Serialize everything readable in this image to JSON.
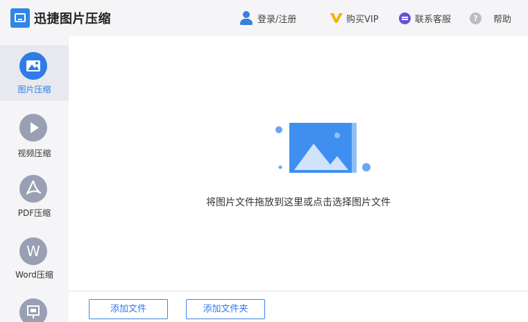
{
  "app": {
    "title": "迅捷图片压缩"
  },
  "header": {
    "login": "登录/注册",
    "vip": "购买VIP",
    "service": "联系客服",
    "help": "帮助",
    "help_glyph": "?"
  },
  "sidebar": {
    "items": [
      {
        "label": "图片压缩",
        "icon": "image-icon",
        "active": true
      },
      {
        "label": "视频压缩",
        "icon": "play-icon",
        "active": false
      },
      {
        "label": "PDF压缩",
        "icon": "pdf-icon",
        "active": false
      },
      {
        "label": "Word压缩",
        "icon": "word-icon",
        "glyph": "W",
        "active": false
      },
      {
        "label": "",
        "icon": "presentation-icon",
        "active": false
      }
    ]
  },
  "main": {
    "drop_hint": "将图片文件拖放到这里或点击选择图片文件"
  },
  "footer": {
    "add_file": "添加文件",
    "add_folder": "添加文件夹"
  },
  "colors": {
    "accent": "#2f7be8",
    "vip": "#f0b400",
    "service": "#6a4fd6",
    "sidebar_icon": "#9aa0b3"
  }
}
